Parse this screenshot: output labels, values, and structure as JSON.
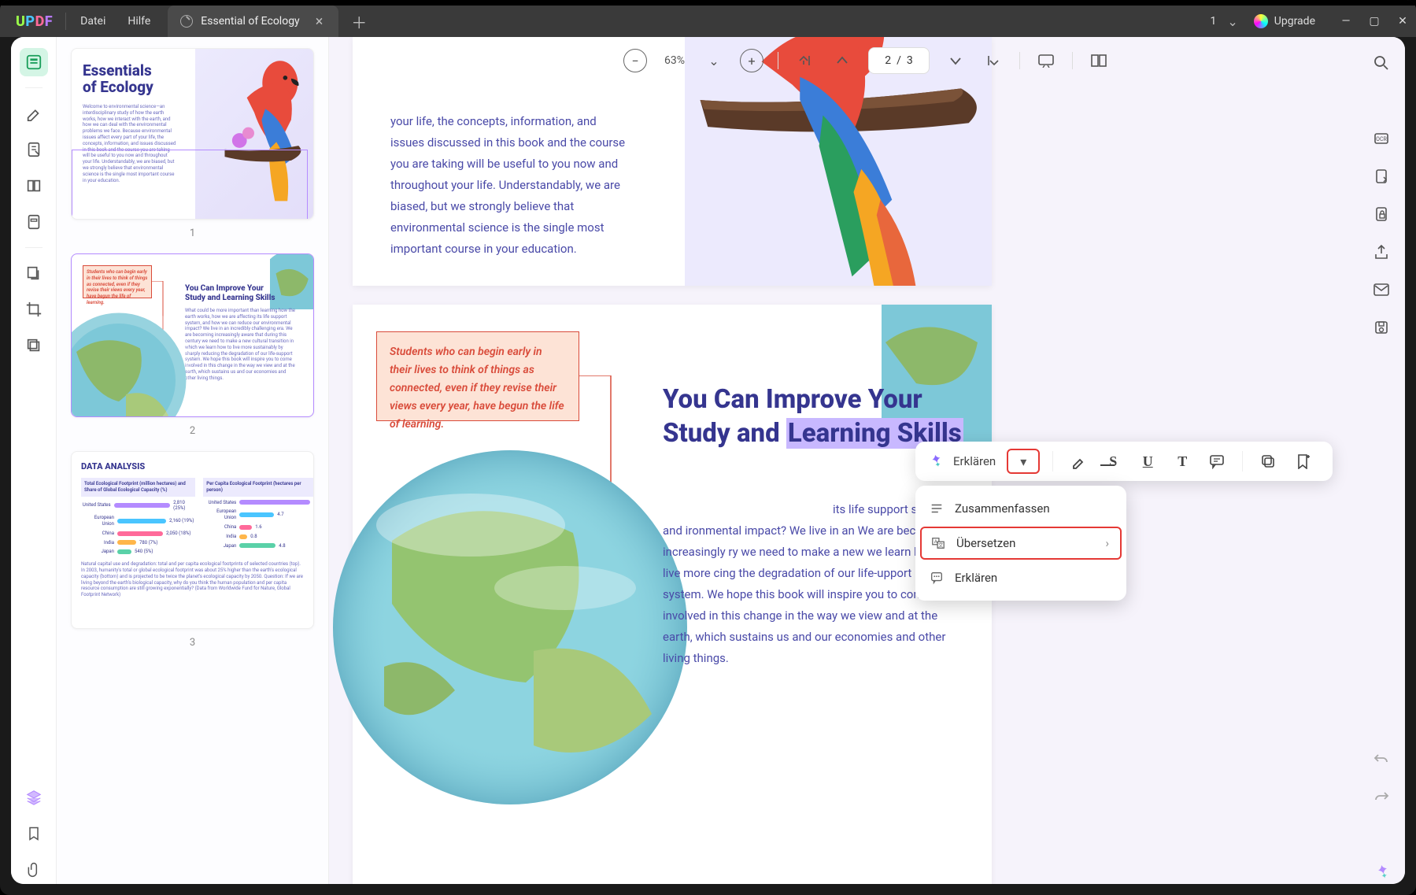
{
  "app": {
    "logo": "UPDF",
    "menus": [
      "Datei",
      "Hilfe"
    ],
    "tab_title": "Essential of Ecology",
    "tab_count": "1",
    "upgrade": "Upgrade"
  },
  "toolbar": {
    "zoom": "63%",
    "page": "2  /  3"
  },
  "thumbs": [
    "1",
    "2",
    "3"
  ],
  "thumb1": {
    "title1": "Essentials",
    "title2": "of Ecology",
    "body": "Welcome to environmental science—an interdisciplinary study of how the earth works, how we interact with the earth, and how we can deal with the environmental problems we face. Because environmental issues affect every part of your life, the concepts, information, and issues discussed in this book and the course you are taking will be useful to you now and throughout your life. Understandably, we are biased, but we strongly believe that environmental science is the single most important course in your education."
  },
  "thumb2": {
    "quote": "Students who can begin early in their lives to think of things as connected, even if they revise their views every year, have begun the life of learning.",
    "h1": "You Can Improve Your",
    "h2": "Study and Learning Skills",
    "body": "What could be more important than learning how the earth works, how we are affecting its life support system, and how we can reduce our environmental impact? We live in an incredibly challenging era. We are becoming increasingly aware that during this century we need to make a new cultural transition in which we learn how to live more sustainably by sharply reducing the degradation of our life-support system. We hope this book will inspire you to come involved in this change in the way we view and at the earth, which sustains us and our economies and other living things."
  },
  "thumb3": {
    "title": "DATA ANALYSIS",
    "left_title": "Total Ecological Footprint (million hectares) and Share of Global Ecological Capacity (%)",
    "right_title": "Per Capita Ecological Footprint (hectares per person)",
    "rows_left": [
      {
        "label": "United States",
        "val": "2,810 (25%)"
      },
      {
        "label": "European Union",
        "val": "2,160 (19%)"
      },
      {
        "label": "China",
        "val": "2,050 (18%)"
      },
      {
        "label": "India",
        "val": "780 (7%)"
      },
      {
        "label": "Japan",
        "val": "540 (5%)"
      }
    ],
    "rows_right": [
      {
        "label": "United States",
        "val": "9.7"
      },
      {
        "label": "European Union",
        "val": "4.7"
      },
      {
        "label": "China",
        "val": "1.6"
      },
      {
        "label": "India",
        "val": "0.8"
      },
      {
        "label": "Japan",
        "val": "4.8"
      }
    ],
    "caption": "Natural capital use and degradation: total and per capita ecological footprints of selected countries (top). In 2003, humanity's total or global ecological footprint was about 25% higher than the earth's ecological capacity (bottom) and is projected to be twice the planet's ecological capacity by 2050. Question: If we are living beyond the earth's biological capacity, why do you think the human population and per capita resource consumption are still growing exponentially? (Data from Worldwide Fund for Nature, Global Footprint Network)"
  },
  "page1": {
    "body": "your life, the concepts, information, and issues discussed in this book and the course you are taking will be useful to you now and throughout your life. Understandably, we are biased, but we strongly believe that environmental science is the single most important course in your education."
  },
  "page2": {
    "quote": "Students who can begin early in their lives to think of things as connected, even if they revise their views every year, have begun the life of learning.",
    "h_line1": "You Can Improve Your",
    "h_line2a": "Study and ",
    "h_line2b": "Learning Skills",
    "body": "its life support system, and ironmental impact? We live in an We are becoming increasingly ry we need to make a new we learn how to live more cing the degradation of our life-upport system. We hope this book will inspire you to come involved in this change in the way we view and at the earth, which sustains us and our economies and other living things."
  },
  "context": {
    "label": "Erklären",
    "items": [
      "Zusammenfassen",
      "Übersetzen",
      "Erklären"
    ]
  }
}
